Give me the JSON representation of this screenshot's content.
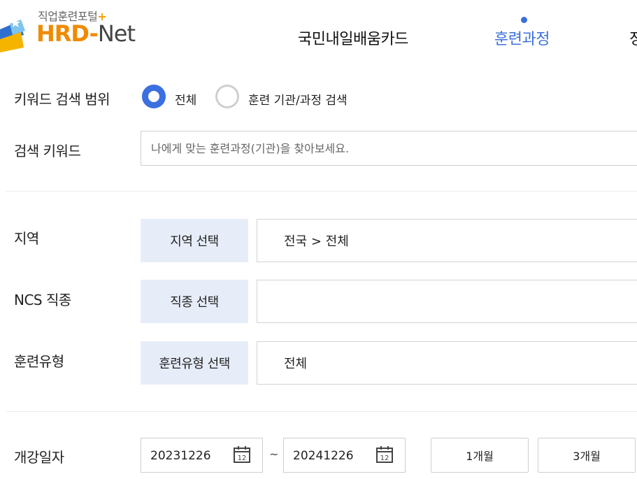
{
  "logo": {
    "small_text": "직업훈련포털",
    "plus": "+",
    "hrd": "HRD",
    "dash": "-",
    "net": "Net"
  },
  "nav": {
    "items": [
      {
        "label": "국민내일배움카드"
      },
      {
        "label": "훈련과정"
      },
      {
        "label": "정"
      }
    ],
    "active_index": 1,
    "accent_color": "#3a6fd8"
  },
  "search_scope": {
    "label": "키워드 검색 범위",
    "options": [
      {
        "label": "전체",
        "selected": true
      },
      {
        "label": "훈련 기관/과정 검색",
        "selected": false
      }
    ]
  },
  "keyword": {
    "label": "검색 키워드",
    "value": "",
    "placeholder": "나에게 맞는 훈련과정(기관)을 찾아보세요."
  },
  "region": {
    "label": "지역",
    "button": "지역 선택",
    "value": "전국 > 전체"
  },
  "ncs": {
    "label": "NCS 직종",
    "button": "직종 선택",
    "value": ""
  },
  "training_type": {
    "label": "훈련유형",
    "button": "훈련유형 선택",
    "value": "전체"
  },
  "start_date": {
    "label": "개강일자",
    "from": "20231226",
    "separator": "~",
    "to": "20241226",
    "calendar_day": "12",
    "periods": [
      "1개월",
      "3개월"
    ]
  }
}
